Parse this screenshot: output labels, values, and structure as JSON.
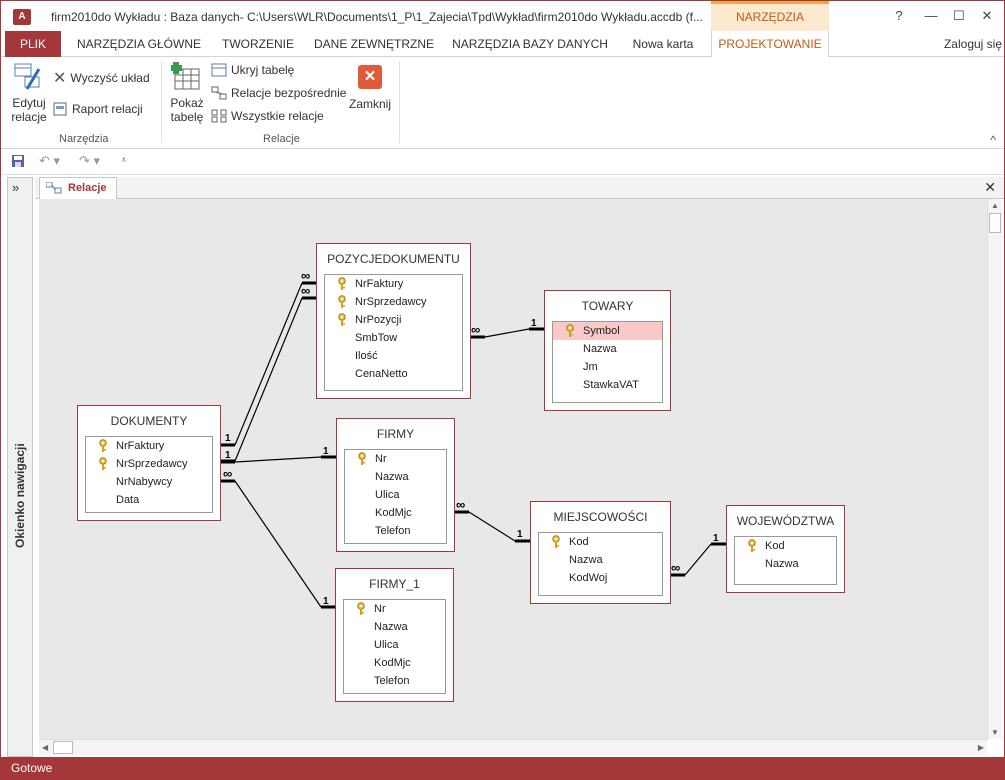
{
  "window": {
    "title": "firm2010do Wykładu : Baza danych- C:\\Users\\WLR\\Documents\\1_P\\1_Zajecia\\Tpd\\Wykład\\firm2010do Wykładu.accdb (f...",
    "app_icon": "A",
    "context_tab": "NARZĘDZIA RELACJI",
    "help_icon": "?",
    "controls": {
      "minimize": "—",
      "maximize": "☐",
      "close": "✕"
    }
  },
  "tabs": [
    {
      "label": "PLIK"
    },
    {
      "label": "NARZĘDZIA GŁÓWNE"
    },
    {
      "label": "TWORZENIE"
    },
    {
      "label": "DANE ZEWNĘTRZNE"
    },
    {
      "label": "NARZĘDZIA BAZY DANYCH"
    },
    {
      "label": "Nowa karta"
    },
    {
      "label": "PROJEKTOWANIE"
    }
  ],
  "signin": "Zaloguj się",
  "ribbon": {
    "edit_relations": {
      "line1": "Edytuj",
      "line2": "relacje"
    },
    "clear_layout": "Wyczyść układ",
    "relation_report": "Raport relacji",
    "group_tools": "Narzędzia",
    "show_table": {
      "line1": "Pokaż",
      "line2": "tabelę"
    },
    "hide_table": "Ukryj tabelę",
    "direct_relations": "Relacje bezpośrednie",
    "all_relations": "Wszystkie relacje",
    "close": "Zamknij",
    "group_relations": "Relacje",
    "collapse": "^"
  },
  "nav_pane": {
    "toggle": "»",
    "label": "Okienko nawigacji"
  },
  "doc_tab": {
    "label": "Relacje",
    "close": "✕"
  },
  "tables": {
    "dokumenty": {
      "name": "DOKUMENTY",
      "fields": [
        {
          "name": "NrFaktury",
          "key": true
        },
        {
          "name": "NrSprzedawcy",
          "key": true
        },
        {
          "name": "NrNabywcy",
          "key": false
        },
        {
          "name": "Data",
          "key": false
        }
      ]
    },
    "pozycje": {
      "name": "POZYCJEDOKUMENTU",
      "fields": [
        {
          "name": "NrFaktury",
          "key": true
        },
        {
          "name": "NrSprzedawcy",
          "key": true
        },
        {
          "name": "NrPozycji",
          "key": true
        },
        {
          "name": "SmbTow",
          "key": false
        },
        {
          "name": "Ilość",
          "key": false
        },
        {
          "name": "CenaNetto",
          "key": false
        }
      ]
    },
    "towary": {
      "name": "TOWARY",
      "fields": [
        {
          "name": "Symbol",
          "key": true
        },
        {
          "name": "Nazwa",
          "key": false
        },
        {
          "name": "Jm",
          "key": false
        },
        {
          "name": "StawkaVAT",
          "key": false
        }
      ]
    },
    "firmy": {
      "name": "FIRMY",
      "fields": [
        {
          "name": "Nr",
          "key": true
        },
        {
          "name": "Nazwa",
          "key": false
        },
        {
          "name": "Ulica",
          "key": false
        },
        {
          "name": "KodMjc",
          "key": false
        },
        {
          "name": "Telefon",
          "key": false
        }
      ]
    },
    "firmy1": {
      "name": "FIRMY_1",
      "fields": [
        {
          "name": "Nr",
          "key": true
        },
        {
          "name": "Nazwa",
          "key": false
        },
        {
          "name": "Ulica",
          "key": false
        },
        {
          "name": "KodMjc",
          "key": false
        },
        {
          "name": "Telefon",
          "key": false
        }
      ]
    },
    "miejscowosci": {
      "name": "MIEJSCOWOŚCI",
      "fields": [
        {
          "name": "Kod",
          "key": true
        },
        {
          "name": "Nazwa",
          "key": false
        },
        {
          "name": "KodWoj",
          "key": false
        }
      ]
    },
    "wojewodztwa": {
      "name": "WOJEWÓDZTWA",
      "fields": [
        {
          "name": "Kod",
          "key": true
        },
        {
          "name": "Nazwa",
          "key": false
        }
      ]
    }
  },
  "cardinality": {
    "one": "1",
    "many": "∞"
  },
  "status": "Gotowe",
  "colors": {
    "accent": "#a4373a",
    "context": "#c55a11",
    "selected_field": "#f8c9c9"
  }
}
